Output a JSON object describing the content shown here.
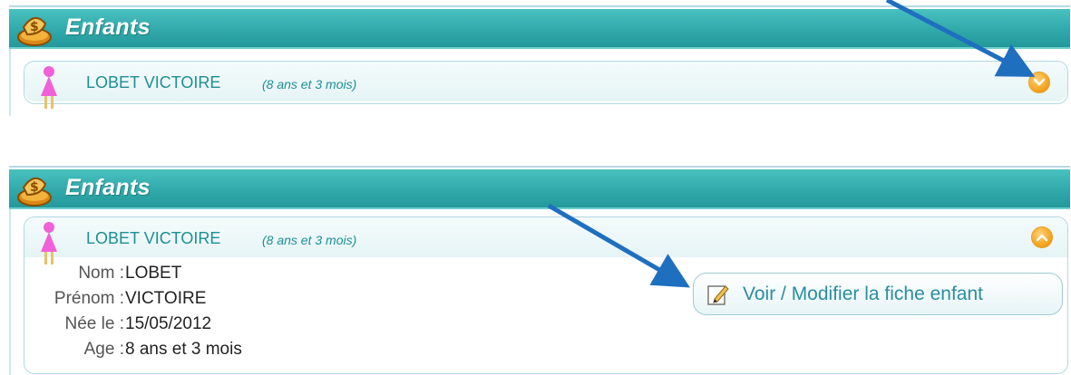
{
  "panels": [
    {
      "title": "Enfants",
      "child": {
        "name": "LOBET VICTOIRE",
        "age_note": "(8 ans et 3 mois)"
      }
    },
    {
      "title": "Enfants",
      "child": {
        "name": "LOBET VICTOIRE",
        "age_note": "(8 ans et 3 mois)"
      },
      "details": [
        {
          "label": "Nom",
          "value": "LOBET"
        },
        {
          "label": "Prénom",
          "value": "VICTOIRE"
        },
        {
          "label": "Née le",
          "value": "15/05/2012"
        },
        {
          "label": "Age",
          "value": "8 ans et 3 mois"
        }
      ],
      "edit_button_label": "Voir / Modifier la fiche enfant"
    }
  ],
  "icons": {
    "header": "money-bag-icon",
    "child": "girl-icon",
    "toggle": "chevron-down-icon",
    "edit": "pencil-note-icon",
    "annotation": "arrow-icon"
  },
  "colors": {
    "header": "#31a8a9",
    "accent_text": "#1e8f93",
    "toggle": "#f5a623",
    "girl": "#f060d8",
    "arrow": "#1f6fbf"
  }
}
